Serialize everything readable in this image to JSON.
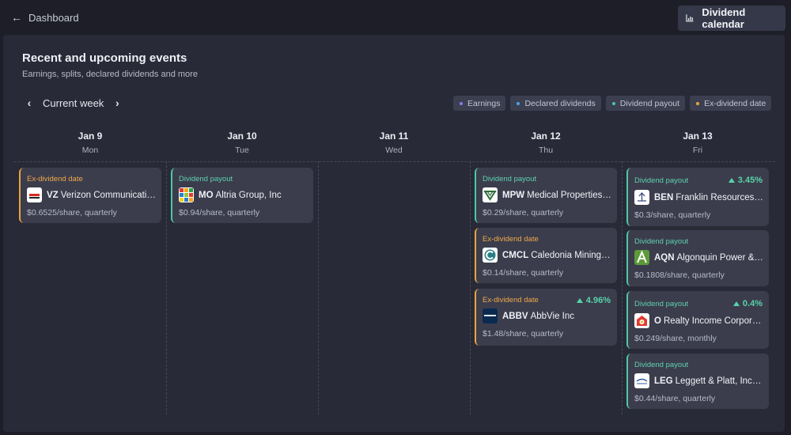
{
  "topbar": {
    "back_label": "Dashboard",
    "calendar_button": "Dividend calendar"
  },
  "header": {
    "title": "Recent and upcoming events",
    "subtitle": "Earnings, splits, declared dividends and more"
  },
  "week_nav": {
    "label": "Current week"
  },
  "legend": [
    {
      "label": "Earnings",
      "color": "#8a7cf0"
    },
    {
      "label": "Declared dividends",
      "color": "#4aa8e8"
    },
    {
      "label": "Dividend payout",
      "color": "#4fc7a6"
    },
    {
      "label": "Ex-dividend date",
      "color": "#e8a43f"
    }
  ],
  "days": [
    {
      "date": "Jan 9",
      "weekday": "Mon"
    },
    {
      "date": "Jan 10",
      "weekday": "Tue"
    },
    {
      "date": "Jan 11",
      "weekday": "Wed"
    },
    {
      "date": "Jan 12",
      "weekday": "Thu"
    },
    {
      "date": "Jan 13",
      "weekday": "Fri"
    }
  ],
  "events": {
    "mon": [
      {
        "type": "Ex-dividend date",
        "ticker": "VZ",
        "company": "Verizon Communicatio…",
        "amount": "$0.6525/share, quarterly",
        "logo": "verizon-logo"
      }
    ],
    "tue": [
      {
        "type": "Dividend payout",
        "ticker": "MO",
        "company": "Altria Group, Inc",
        "amount": "$0.94/share, quarterly",
        "logo": "altria-logo"
      }
    ],
    "thu": [
      {
        "type": "Dividend payout",
        "ticker": "MPW",
        "company": "Medical Properties …",
        "amount": "$0.29/share, quarterly",
        "logo": "mpw-logo"
      },
      {
        "type": "Ex-dividend date",
        "ticker": "CMCL",
        "company": "Caledonia Mining C…",
        "amount": "$0.14/share, quarterly",
        "logo": "caledonia-logo"
      },
      {
        "type": "Ex-dividend date",
        "ticker": "ABBV",
        "company": "AbbVie Inc",
        "amount": "$1.48/share, quarterly",
        "change": "4.96%",
        "logo": "abbvie-logo"
      }
    ],
    "fri": [
      {
        "type": "Dividend payout",
        "ticker": "BEN",
        "company": "Franklin Resources, I…",
        "amount": "$0.3/share, quarterly",
        "change": "3.45%",
        "logo": "franklin-logo"
      },
      {
        "type": "Dividend payout",
        "ticker": "AQN",
        "company": "Algonquin Power & …",
        "amount": "$0.1808/share, quarterly",
        "logo": "algonquin-logo"
      },
      {
        "type": "Dividend payout",
        "ticker": "O",
        "company": "Realty Income Corporat…",
        "amount": "$0.249/share, monthly",
        "change": "0.4%",
        "logo": "realty-income-logo"
      },
      {
        "type": "Dividend payout",
        "ticker": "LEG",
        "company": "Leggett & Platt, Incor…",
        "amount": "$0.44/share, quarterly",
        "logo": "leggett-logo"
      }
    ]
  }
}
